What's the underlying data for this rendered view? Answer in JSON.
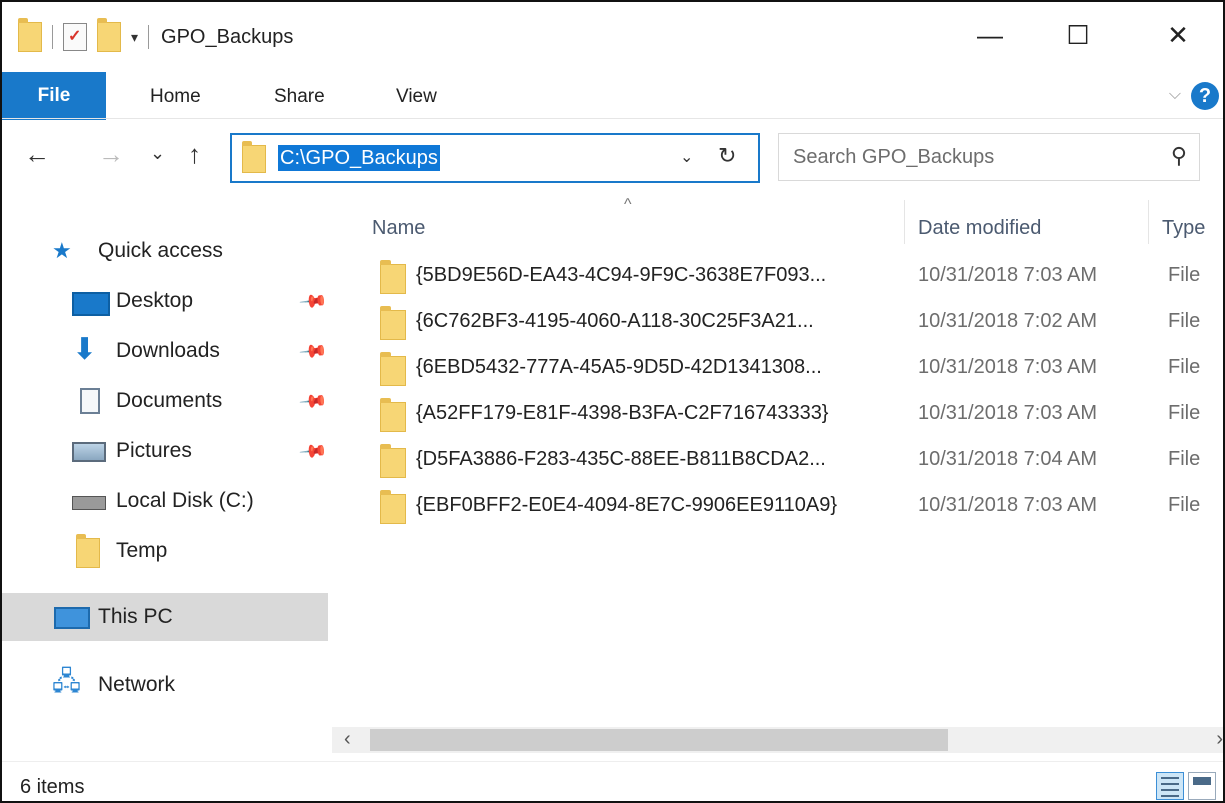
{
  "window": {
    "title": "GPO_Backups",
    "qat_dropdown": "▾",
    "controls": {
      "minimize": "—",
      "maximize": "☐",
      "close": "✕"
    }
  },
  "ribbon": {
    "tabs": [
      "File",
      "Home",
      "Share",
      "View"
    ],
    "help": "?",
    "collapse": "⌵"
  },
  "nav": {
    "back": "←",
    "forward": "→",
    "recent": "⌄",
    "up": "↑",
    "address": "C:\\GPO_Backups",
    "address_dropdown": "⌄",
    "refresh": "↻",
    "search_placeholder": "Search GPO_Backups",
    "search_icon": "⚲"
  },
  "navpane": {
    "quick_access": "Quick access",
    "items": [
      {
        "label": "Desktop",
        "icon": "desktop-icon",
        "pinned": true
      },
      {
        "label": "Downloads",
        "icon": "downloads-icon",
        "pinned": true
      },
      {
        "label": "Documents",
        "icon": "documents-icon",
        "pinned": true
      },
      {
        "label": "Pictures",
        "icon": "pictures-icon",
        "pinned": true
      },
      {
        "label": "Local Disk (C:)",
        "icon": "local-disk-icon",
        "pinned": false
      },
      {
        "label": "Temp",
        "icon": "folder-icon",
        "pinned": false
      }
    ],
    "this_pc": "This PC",
    "network": "Network",
    "pin_glyph": "📌"
  },
  "list": {
    "sort_caret": "^",
    "columns": {
      "name": "Name",
      "date": "Date modified",
      "type": "Type"
    },
    "rows": [
      {
        "name": "{5BD9E56D-EA43-4C94-9F9C-3638E7F093...",
        "date": "10/31/2018 7:03 AM",
        "type": "File"
      },
      {
        "name": "{6C762BF3-4195-4060-A118-30C25F3A21...",
        "date": "10/31/2018 7:02 AM",
        "type": "File"
      },
      {
        "name": "{6EBD5432-777A-45A5-9D5D-42D1341308...",
        "date": "10/31/2018 7:03 AM",
        "type": "File"
      },
      {
        "name": "{A52FF179-E81F-4398-B3FA-C2F716743333}",
        "date": "10/31/2018 7:03 AM",
        "type": "File"
      },
      {
        "name": "{D5FA3886-F283-435C-88EE-B811B8CDA2...",
        "date": "10/31/2018 7:04 AM",
        "type": "File"
      },
      {
        "name": "{EBF0BFF2-E0E4-4094-8E7C-9906EE9110A9}",
        "date": "10/31/2018 7:03 AM",
        "type": "File"
      }
    ]
  },
  "scroll": {
    "left": "‹",
    "right": "›"
  },
  "status": {
    "items": "6 items"
  },
  "colors": {
    "accent": "#1979ca",
    "folder": "#f7d675",
    "selection": "#0f78d7"
  }
}
